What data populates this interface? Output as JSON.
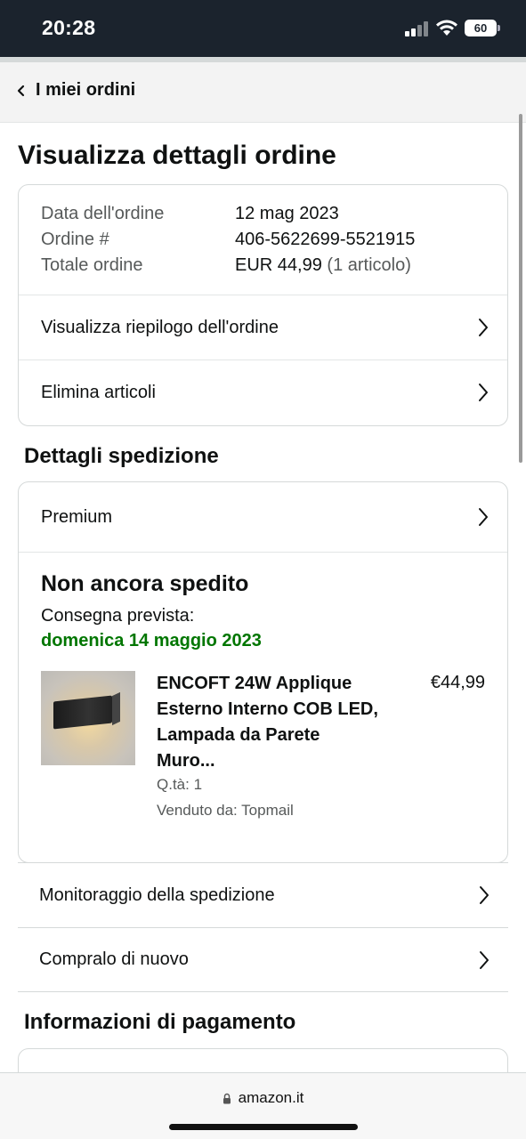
{
  "status_bar": {
    "time": "20:28",
    "battery": "60"
  },
  "nav": {
    "back_label": "I miei ordini"
  },
  "page": {
    "title": "Visualizza dettagli ordine"
  },
  "order": {
    "date_label": "Data dell'ordine",
    "date_value": "12 mag 2023",
    "number_label": "Ordine #",
    "number_value": "406-5622699-5521915",
    "total_label": "Totale ordine",
    "total_value": "EUR 44,99",
    "total_items": "(1 articolo)",
    "summary_link": "Visualizza riepilogo dell'ordine",
    "delete_link": "Elimina articoli"
  },
  "shipping": {
    "section_title": "Dettagli spedizione",
    "method": "Premium",
    "status": "Non ancora spedito",
    "delivery_label": "Consegna prevista:",
    "delivery_date": "domenica 14 maggio 2023",
    "accent_color": "#007600",
    "product": {
      "title": "ENCOFT 24W Applique Esterno Interno COB LED, Lampada da Parete Muro...",
      "price": "€44,99",
      "qty": "Q.tà: 1",
      "seller": "Venduto da: Topmail"
    },
    "track_link": "Monitoraggio della spedizione",
    "buy_again_link": "Compralo di nuovo"
  },
  "payment": {
    "section_title": "Informazioni di pagamento"
  },
  "browser": {
    "url": "amazon.it"
  }
}
